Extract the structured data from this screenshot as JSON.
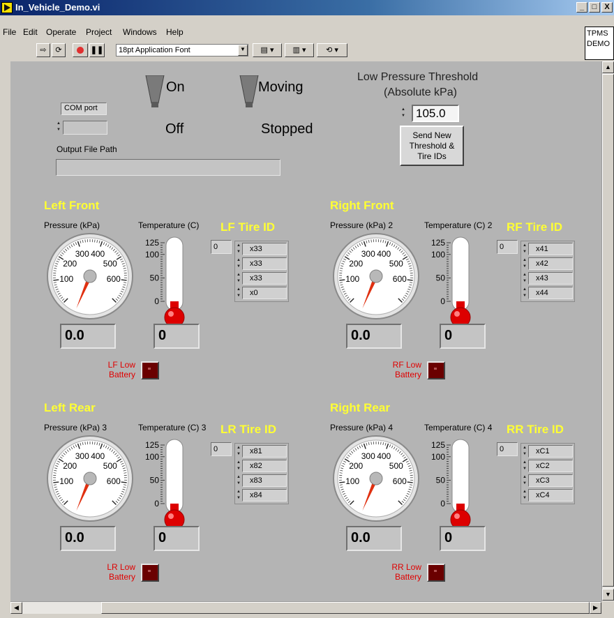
{
  "window": {
    "title": "In_Vehicle_Demo.vi",
    "minimize": "_",
    "maximize": "□",
    "close": "X"
  },
  "menu": [
    "File",
    "Edit",
    "Operate",
    "Project",
    "Windows",
    "Help"
  ],
  "toolbar": {
    "font": "18pt Application Font"
  },
  "side_box": {
    "line1": "TPMS",
    "line2": "DEMO"
  },
  "switches": [
    {
      "on": "On",
      "off": "Off"
    },
    {
      "on": "Moving",
      "off": "Stopped"
    }
  ],
  "threshold": {
    "label1": "Low Pressure Threshold",
    "label2": "(Absolute kPa)",
    "value": "105.0",
    "button": [
      "Send New",
      "Threshold &",
      "Tire IDs"
    ]
  },
  "com_port": {
    "label": "COM port",
    "value": ""
  },
  "output_path": {
    "label": "Output File Path",
    "value": ""
  },
  "gauge_ticks": [
    "100",
    "200",
    "300",
    "400",
    "500",
    "600"
  ],
  "thermo_ticks": [
    "125",
    "100",
    "50",
    "0"
  ],
  "tires": [
    {
      "title": "Left Front",
      "pressure_label": "Pressure (kPa)",
      "temp_label": "Temperature (C)",
      "id_title": "LF Tire ID",
      "index": "0",
      "ids": [
        "x33",
        "x33",
        "x33",
        "x0"
      ],
      "pressure": "0.0",
      "temp": "0",
      "low_line1": "LF Low",
      "low_line2": "Battery"
    },
    {
      "title": "Right Front",
      "pressure_label": "Pressure (kPa) 2",
      "temp_label": "Temperature (C) 2",
      "id_title": "RF Tire ID",
      "index": "0",
      "ids": [
        "x41",
        "x42",
        "x43",
        "x44"
      ],
      "pressure": "0.0",
      "temp": "0",
      "low_line1": "RF Low",
      "low_line2": "Battery"
    },
    {
      "title": "Left Rear",
      "pressure_label": "Pressure (kPa) 3",
      "temp_label": "Temperature (C) 3",
      "id_title": "LR Tire ID",
      "index": "0",
      "ids": [
        "x81",
        "x82",
        "x83",
        "x84"
      ],
      "pressure": "0.0",
      "temp": "0",
      "low_line1": "LR Low",
      "low_line2": "Battery"
    },
    {
      "title": "Right Rear",
      "pressure_label": "Pressure (kPa) 4",
      "temp_label": "Temperature (C) 4",
      "id_title": "RR Tire ID",
      "index": "0",
      "ids": [
        "xC1",
        "xC2",
        "xC3",
        "xC4"
      ],
      "pressure": "0.0",
      "temp": "0",
      "low_line1": "RR Low",
      "low_line2": "Battery"
    }
  ],
  "colors": {
    "panel": "#b4b4b4",
    "title_yellow": "#ffff33",
    "low_red": "#e00000",
    "led_dark_red": "#6a0000",
    "thermo_bulb": "#dd0000"
  }
}
